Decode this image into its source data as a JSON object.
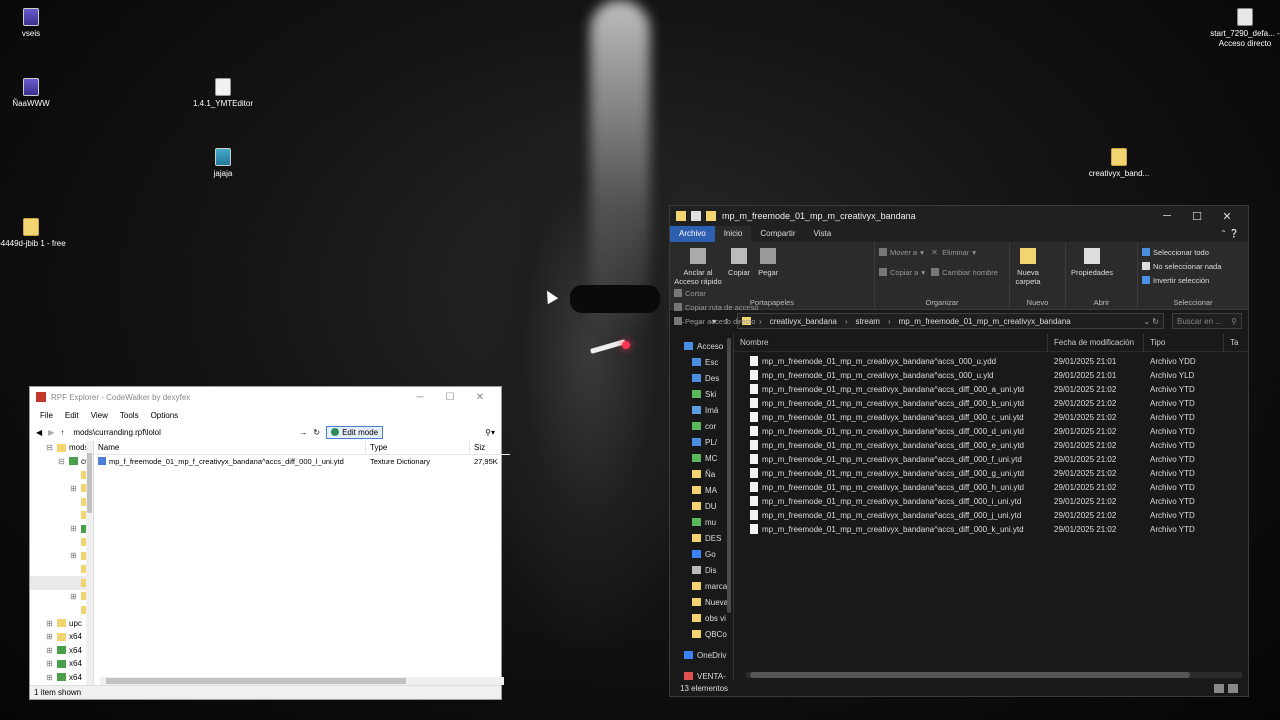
{
  "desktop": {
    "icons": [
      {
        "label": "vseis",
        "type": "rar"
      },
      {
        "label": "ÑaaWWW",
        "type": "rar"
      },
      {
        "label": "1.4.1_YMTEditor",
        "type": "doc"
      },
      {
        "label": "jajaja",
        "type": "app"
      },
      {
        "label": "e4449d-jbib 1 - free",
        "type": "folder"
      },
      {
        "label": "start_7290_defa... - Acceso directo",
        "type": "shortcut"
      },
      {
        "label": "creativyx_band...",
        "type": "folder"
      }
    ]
  },
  "explorer": {
    "title": "mp_m_freemode_01_mp_m_creativyx_bandana",
    "window_controls": {
      "minimize": "─",
      "maximize": "☐",
      "close": "✕"
    },
    "tabs": [
      "Archivo",
      "Inicio",
      "Compartir",
      "Vista"
    ],
    "active_tab": "Inicio",
    "ribbon": {
      "portapapeles": {
        "label": "Portapapeles",
        "anclar": "Anclar al Acceso rápido",
        "copiar": "Copiar",
        "pegar": "Pegar",
        "cortar": "Cortar",
        "copiar_ruta": "Copiar ruta de acceso",
        "pegar_acceso": "Pegar acceso directo"
      },
      "organizar": {
        "label": "Organizar",
        "mover": "Mover a",
        "copiar_a": "Copiar a",
        "eliminar": "Eliminar",
        "cambiar_nombre": "Cambiar nombre"
      },
      "nuevo": {
        "label": "Nuevo",
        "nueva_carpeta": "Nueva carpeta"
      },
      "abrir": {
        "label": "Abrir",
        "propiedades": "Propiedades"
      },
      "seleccionar": {
        "label": "Seleccionar",
        "todo": "Seleccionar todo",
        "nada": "No seleccionar nada",
        "invertir": "Invertir selección"
      }
    },
    "address": {
      "segments": [
        "creativyx_bandana",
        "stream",
        "mp_m_freemode_01_mp_m_creativyx_bandana"
      ],
      "search_placeholder": "Buscar en ..."
    },
    "nav_items": [
      {
        "label": "Acceso",
        "color": "#4a8fe0"
      },
      {
        "label": "Esc",
        "color": "#4a8fe0"
      },
      {
        "label": "Des",
        "color": "#4a8fe0"
      },
      {
        "label": "Ski",
        "color": "#5cb85c"
      },
      {
        "label": "Imá",
        "color": "#5c9ee0"
      },
      {
        "label": "cor",
        "color": "#5cb85c"
      },
      {
        "label": "PL/",
        "color": "#4a8fe0"
      },
      {
        "label": "MC",
        "color": "#5cb85c"
      },
      {
        "label": "Ña",
        "color": "#f2d571"
      },
      {
        "label": "MA",
        "color": "#f2d571"
      },
      {
        "label": "DU",
        "color": "#f2d571"
      },
      {
        "label": "mu",
        "color": "#5cb85c"
      },
      {
        "label": "DES",
        "color": "#f2d571"
      },
      {
        "label": "Go",
        "color": "#3b82f6"
      },
      {
        "label": "Dis",
        "color": "#bbbbbb"
      },
      {
        "label": "marca",
        "color": "#f2d571"
      },
      {
        "label": "Nueva",
        "color": "#f2d571"
      },
      {
        "label": "obs vi",
        "color": "#f2d571"
      },
      {
        "label": "QBCo",
        "color": "#f2d571"
      },
      {
        "label": "OneDriv",
        "color": "#3b82f6"
      },
      {
        "label": "VENTA-",
        "color": "#e05050"
      }
    ],
    "columns": {
      "name": "Nombre",
      "date": "Fecha de modificación",
      "type": "Tipo",
      "size": "Ta"
    },
    "files": [
      {
        "name": "mp_m_freemode_01_mp_m_creativyx_bandana^accs_000_u.ydd",
        "date": "29/01/2025 21:01",
        "type": "Archivo YDD"
      },
      {
        "name": "mp_m_freemode_01_mp_m_creativyx_bandana^accs_000_u.yld",
        "date": "29/01/2025 21:01",
        "type": "Archivo YLD"
      },
      {
        "name": "mp_m_freemode_01_mp_m_creativyx_bandana^accs_diff_000_a_uni.ytd",
        "date": "29/01/2025 21:02",
        "type": "Archivo YTD"
      },
      {
        "name": "mp_m_freemode_01_mp_m_creativyx_bandana^accs_diff_000_b_uni.ytd",
        "date": "29/01/2025 21:02",
        "type": "Archivo YTD"
      },
      {
        "name": "mp_m_freemode_01_mp_m_creativyx_bandana^accs_diff_000_c_uni.ytd",
        "date": "29/01/2025 21:02",
        "type": "Archivo YTD"
      },
      {
        "name": "mp_m_freemode_01_mp_m_creativyx_bandana^accs_diff_000_d_uni.ytd",
        "date": "29/01/2025 21:02",
        "type": "Archivo YTD"
      },
      {
        "name": "mp_m_freemode_01_mp_m_creativyx_bandana^accs_diff_000_e_uni.ytd",
        "date": "29/01/2025 21:02",
        "type": "Archivo YTD"
      },
      {
        "name": "mp_m_freemode_01_mp_m_creativyx_bandana^accs_diff_000_f_uni.ytd",
        "date": "29/01/2025 21:02",
        "type": "Archivo YTD"
      },
      {
        "name": "mp_m_freemode_01_mp_m_creativyx_bandana^accs_diff_000_g_uni.ytd",
        "date": "29/01/2025 21:02",
        "type": "Archivo YTD"
      },
      {
        "name": "mp_m_freemode_01_mp_m_creativyx_bandana^accs_diff_000_h_uni.ytd",
        "date": "29/01/2025 21:02",
        "type": "Archivo YTD"
      },
      {
        "name": "mp_m_freemode_01_mp_m_creativyx_bandana^accs_diff_000_i_uni.ytd",
        "date": "29/01/2025 21:02",
        "type": "Archivo YTD"
      },
      {
        "name": "mp_m_freemode_01_mp_m_creativyx_bandana^accs_diff_000_j_uni.ytd",
        "date": "29/01/2025 21:02",
        "type": "Archivo YTD"
      },
      {
        "name": "mp_m_freemode_01_mp_m_creativyx_bandana^accs_diff_000_k_uni.ytd",
        "date": "29/01/2025 21:02",
        "type": "Archivo YTD"
      }
    ],
    "status": "13 elementos"
  },
  "codewalker": {
    "title": "RPF Explorer - CodeWalker by dexyfex",
    "menu": [
      "File",
      "Edit",
      "View",
      "Tools",
      "Options"
    ],
    "path": "mods\\curranding.rpf\\lolol",
    "edit_mode": "Edit mode",
    "tree": [
      {
        "label": "mods",
        "indent": 1,
        "expander": "⊟",
        "green": false
      },
      {
        "label": "cur",
        "indent": 2,
        "expander": "⊟",
        "green": true
      },
      {
        "label": "",
        "indent": 3,
        "expander": "",
        "green": false
      },
      {
        "label": "",
        "indent": 3,
        "expander": "⊞",
        "green": false
      },
      {
        "label": "",
        "indent": 3,
        "expander": "",
        "green": false
      },
      {
        "label": "",
        "indent": 3,
        "expander": "",
        "green": false
      },
      {
        "label": "",
        "indent": 3,
        "expander": "⊞",
        "green": true
      },
      {
        "label": "",
        "indent": 3,
        "expander": "",
        "green": false
      },
      {
        "label": "",
        "indent": 3,
        "expander": "⊞",
        "green": false
      },
      {
        "label": "",
        "indent": 3,
        "expander": "",
        "green": false
      },
      {
        "label": "",
        "indent": 3,
        "expander": "",
        "green": false
      },
      {
        "label": "",
        "indent": 3,
        "expander": "⊞",
        "green": false
      },
      {
        "label": "",
        "indent": 3,
        "expander": "",
        "green": false
      },
      {
        "label": "upc",
        "indent": 1,
        "expander": "⊞",
        "green": false
      },
      {
        "label": "x64",
        "indent": 1,
        "expander": "⊞",
        "green": false
      },
      {
        "label": "x64",
        "indent": 1,
        "expander": "⊞",
        "green": true
      },
      {
        "label": "x64",
        "indent": 1,
        "expander": "⊞",
        "green": true
      },
      {
        "label": "x64",
        "indent": 1,
        "expander": "⊞",
        "green": true
      }
    ],
    "columns": {
      "name": "Name",
      "type": "Type",
      "size": "Siz"
    },
    "files": [
      {
        "name": "mp_f_freemode_01_mp_f_creativyx_bandana^accs_diff_000_l_uni.ytd",
        "type": "Texture Dictionary",
        "size": "27,95K"
      }
    ],
    "status": "1 item shown"
  }
}
